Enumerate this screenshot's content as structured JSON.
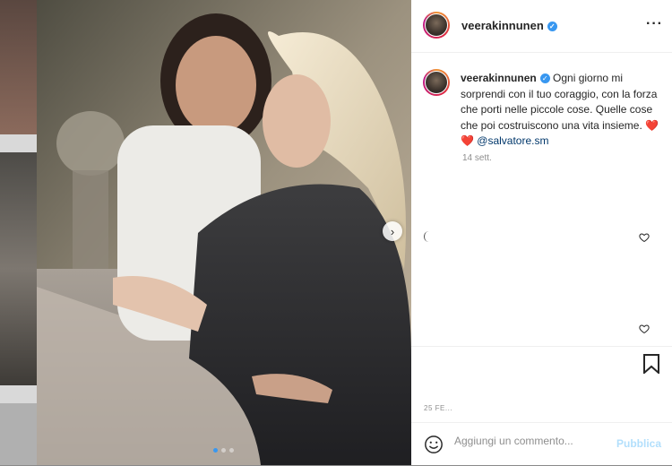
{
  "post": {
    "username": "veerakinnunen",
    "verified_icon": "verified-badge-icon",
    "more_icon": "more-options-icon"
  },
  "caption": {
    "username": "veerakinnunen",
    "text": " Ogni giorno mi sorprendi con il tuo coraggio, con la forza che porti nelle piccole cose. Quelle cose che poi costruiscono una vita insieme. ❤️❤️ ",
    "mention": "@salvatore.sm",
    "time_ago": "14 sett."
  },
  "carousel": {
    "total_slides": 3,
    "active_slide": 1,
    "next_icon": "chevron-right-icon"
  },
  "footer": {
    "date": "25 FE...",
    "comment_placeholder": "Aggiungi un commento...",
    "publish_label": "Pubblica"
  },
  "colors": {
    "accent": "#3897f0",
    "publish_disabled": "#b2dffc",
    "heart": "#ed1c24"
  }
}
